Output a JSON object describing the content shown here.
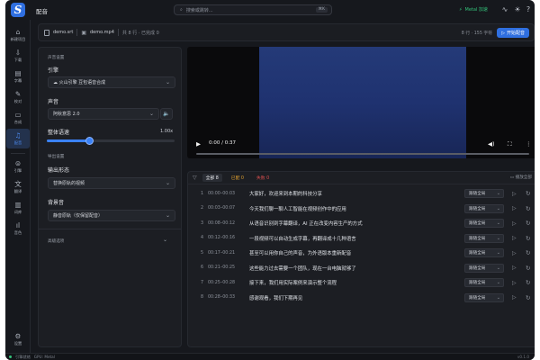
{
  "app": {
    "logo": "S",
    "title": "配音"
  },
  "search": {
    "placeholder": "搜索或跳转...",
    "shortcut": "⌘K"
  },
  "header": {
    "metal_label": "Metal 加速"
  },
  "sidebar": {
    "items": [
      {
        "label": "新建项目",
        "icon": "home-icon"
      },
      {
        "label": "下载",
        "icon": "download-icon"
      },
      {
        "label": "字幕",
        "icon": "subtitle-icon"
      },
      {
        "label": "校对",
        "icon": "edit-icon"
      },
      {
        "label": "合成",
        "icon": "compose-icon"
      },
      {
        "label": "配音",
        "icon": "mic-icon",
        "active": true
      },
      {
        "label": "引擎",
        "icon": "engine-icon"
      },
      {
        "label": "翻译",
        "icon": "translate-icon"
      },
      {
        "label": "词库",
        "icon": "book-icon"
      },
      {
        "label": "音色",
        "icon": "waveform-icon"
      }
    ],
    "settings_label": "设置"
  },
  "filebar": {
    "file1": "demo.srt",
    "file2": "demo.mp4",
    "meta": "共 8 行 · 已完成 0",
    "stats": "8 行 · 155 字符",
    "start_label": "开始配音"
  },
  "settings": {
    "section_voice": "声音设置",
    "engine_label": "引擎",
    "engine_value": "☁ 火山引擎 豆包语音合成",
    "voice_label": "声音",
    "voice_value": "阿秋意思 2.0",
    "speed_label": "整体语速",
    "speed_value_text": "1.00x",
    "speed_fraction": 0.33,
    "section_export": "导出设置",
    "output_label": "输出形态",
    "output_value": "替换原轨的视频",
    "bgm_label": "背景音",
    "bgm_value": "静音原轨（仅保留配音）",
    "advanced_label": "高级选项"
  },
  "video": {
    "time": "0:00 / 0:37",
    "progress_fraction": 0.0
  },
  "list": {
    "filters": [
      {
        "label": "全部 8",
        "active": true
      },
      {
        "label": "已配 0",
        "color": "#e0a030"
      },
      {
        "label": "失败 0",
        "color": "#e05050"
      }
    ],
    "replay_label": "播放全部",
    "action_label": "跟随全局",
    "rows": [
      {
        "num": "1",
        "time": "00:00–00:03",
        "text": "大家好，欢迎来到本期的科技分享"
      },
      {
        "num": "2",
        "time": "00:03–00:07",
        "text": "今天我们聊一聊人工智能在视频创作中的应用"
      },
      {
        "num": "3",
        "time": "00:08–00:12",
        "text": "从语音识别到字幕翻译，AI 正在改变内容生产的方式"
      },
      {
        "num": "4",
        "time": "00:12–00:16",
        "text": "一段视频可以自动生成字幕，再翻译成十几种语言"
      },
      {
        "num": "5",
        "time": "00:17–00:21",
        "text": "甚至可以用你自己的声音，为外语版本重新配音"
      },
      {
        "num": "6",
        "time": "00:21–00:25",
        "text": "这些能力过去需要一个团队，现在一台电脑就够了"
      },
      {
        "num": "7",
        "time": "00:25–00:28",
        "text": "接下来，我们用实际案例来演示整个流程"
      },
      {
        "num": "8",
        "time": "00:28–00:33",
        "text": "感谢观看，我们下期再见"
      }
    ]
  },
  "statusbar": {
    "left": "引擎就绪",
    "gpu": "GPU: Metal",
    "version": "v0.1.0"
  }
}
